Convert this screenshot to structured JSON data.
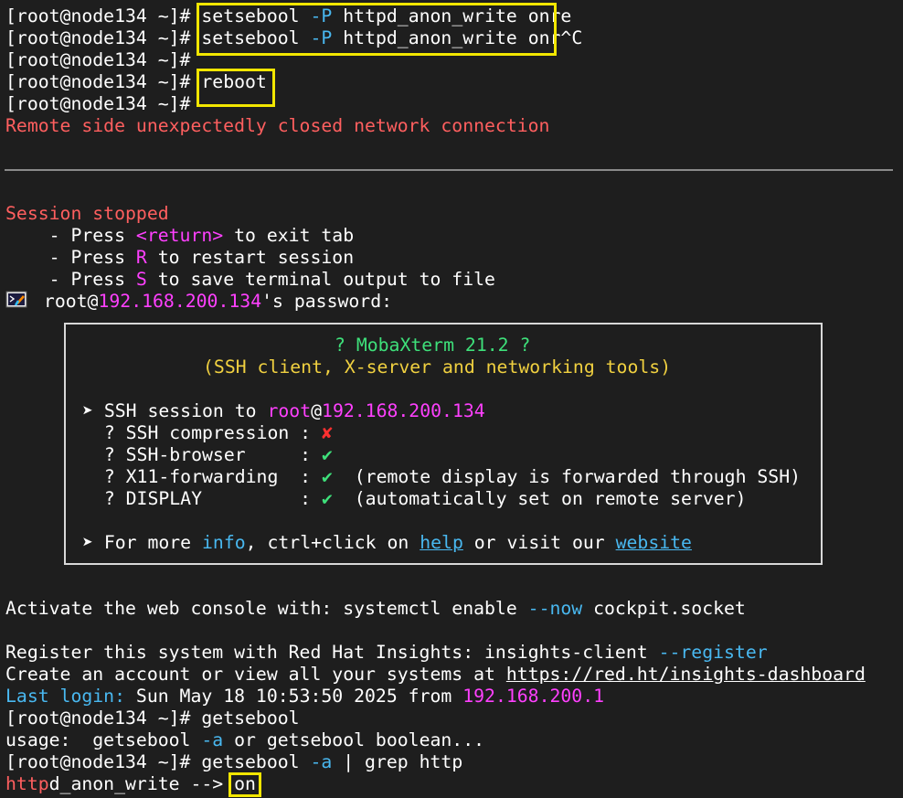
{
  "prompt": "[root@node134 ~]#",
  "lines": {
    "l1_cmd": "setsebool",
    "l1_flag": "-P",
    "l1_rest": "httpd_anon_write onre",
    "l2_cmd": "setsebool",
    "l2_flag": "-P",
    "l2_rest": "httpd_anon_write onr^C",
    "reboot": "reboot",
    "closed": "Remote side unexpectedly closed network connection"
  },
  "session": {
    "stopped": "Session stopped",
    "opt1_a": "    - Press ",
    "opt1_key": "<return>",
    "opt1_b": " to exit tab",
    "opt2_a": "    - Press ",
    "opt2_key": "R",
    "opt2_b": " to restart session",
    "opt3_a": "    - Press ",
    "opt3_key": "S",
    "opt3_b": " to save terminal output to file"
  },
  "login": {
    "user": " root@",
    "host": "192.168.200.134",
    "suffix": "'s password:"
  },
  "banner": {
    "title": "? MobaXterm 21.2 ?",
    "subtitle": "(SSH client, X-server and networking tools)",
    "session_prefix": "➤ SSH session to ",
    "session_user": "root",
    "session_at": "@",
    "session_host": "192.168.200.134",
    "compression_label": "  ? SSH compression : ",
    "compression_value": "✘",
    "browser_label": "  ? SSH-browser     : ",
    "browser_value": "✔",
    "x11_label": "  ? X11-forwarding  : ",
    "x11_value": "✔",
    "x11_note": "  (remote display is forwarded through SSH)",
    "display_label": "  ? DISPLAY         : ",
    "display_value": "✔",
    "display_note": "  (automatically set on remote server)",
    "more_a": "➤ For more ",
    "more_info": "info",
    "more_b": ", ctrl+click on ",
    "more_help": "help",
    "more_c": " or visit our ",
    "more_website": "website"
  },
  "motd": {
    "web_a": "Activate the web console with: systemctl enable ",
    "web_flag": "--now",
    "web_b": " cockpit.socket",
    "reg_a": "Register this system with Red Hat Insights: insights-client ",
    "reg_flag": "--register",
    "acct_a": "Create an account or view all your systems at ",
    "acct_url": "https://red.ht/insights-dashboard",
    "last_label": "Last login:",
    "last_a": " Sun May 18 10:53:50 2025 from ",
    "last_ip": "192.168.200.1"
  },
  "tail": {
    "cmd1": "getsebool",
    "usage_a": "usage:  getsebool ",
    "usage_flag": "-a",
    "usage_b": " or getsebool boolean...",
    "cmd2_a": "getsebool ",
    "cmd2_flag": "-a",
    "cmd2_b": " | grep http",
    "out_match": "http",
    "out_rest": "d_anon_write --> ",
    "out_value": "on"
  }
}
